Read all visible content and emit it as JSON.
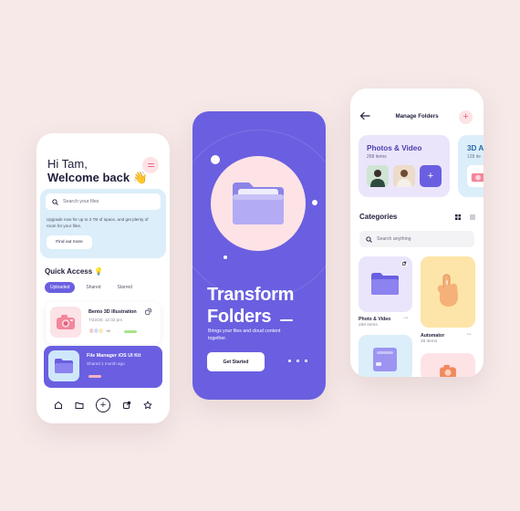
{
  "colors": {
    "background": "#f6e9e8",
    "accent": "#6a5fe0",
    "pink": "#fde3e6",
    "light_blue": "#dbeefa"
  },
  "home": {
    "greeting": "Hi Tam,",
    "welcome": "Welcome back 👋",
    "search_placeholder": "Search your files",
    "upgrade_text": "Upgrade now for up to 2 TB of space, and get plenty of room for your files.",
    "find_out_more": "Find out more",
    "quick_access_title": "Quick Access 💡",
    "tabs": [
      "Uploaded",
      "Shared",
      "Starred"
    ],
    "files": [
      {
        "title": "Bento 3D Illustration",
        "meta": "7/22/20, 12:32 pm",
        "extra": "+6"
      },
      {
        "title": "File Manager iOS UI Kit",
        "meta": "Shared 1 month ago"
      }
    ],
    "nav": [
      "home-icon",
      "folder-icon",
      "add-icon",
      "share-icon",
      "star-icon"
    ]
  },
  "onboarding": {
    "title_line1": "Transform",
    "title_line2": "Folders",
    "subtitle": "Brings your files and cloud content together.",
    "cta": "Get Started"
  },
  "manage": {
    "header": "Manage Folders",
    "folders": [
      {
        "name": "Photos & Video",
        "count": "268 items"
      },
      {
        "name": "3D A",
        "count": "128 ite"
      }
    ],
    "categories_title": "Categories",
    "search_placeholder": "Search anything",
    "tiles": [
      {
        "name": "Photo & Video",
        "count": "268 items"
      },
      {
        "name": "Automator",
        "count": "28 items"
      }
    ]
  }
}
